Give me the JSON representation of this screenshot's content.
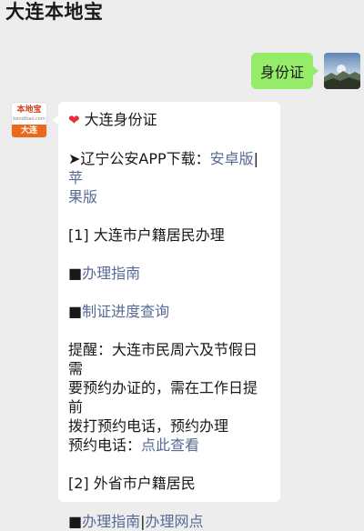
{
  "header": {
    "title": "大连本地宝"
  },
  "outgoing": {
    "text": "身份证"
  },
  "bot": {
    "logo_top": "本地宝",
    "logo_mid": "bendibao.com",
    "logo_bottom": "大连"
  },
  "reply": {
    "heart": "❤",
    "title": "大连身份证",
    "app_prefix": "➤辽宁公安APP下载：",
    "android_link": "安卓版",
    "separator": "|",
    "apple_link_1": "苹",
    "apple_link_2": "果版",
    "section1": "[1] 大连市户籍居民办理",
    "bullet": "■",
    "guide_link": "办理指南",
    "progress_link": "制证进度查询",
    "remind_lines": [
      "提醒：大连市民周六及节假日需",
      "要预约办证的，需在工作日提前",
      "拨打预约电话，预约办理"
    ],
    "phone_prefix": "预约电话：",
    "phone_link": "点此查看",
    "section2": "[2] 外省市户籍居民",
    "guide_link_2": "办理指南",
    "outlet_link": "办理网点"
  },
  "colors": {
    "background": "#ededed",
    "outgoing_bubble": "#95ec69",
    "incoming_bubble": "#ffffff",
    "link": "#576b95",
    "heart": "#e52d3d",
    "logo_orange": "#e86a1a"
  }
}
